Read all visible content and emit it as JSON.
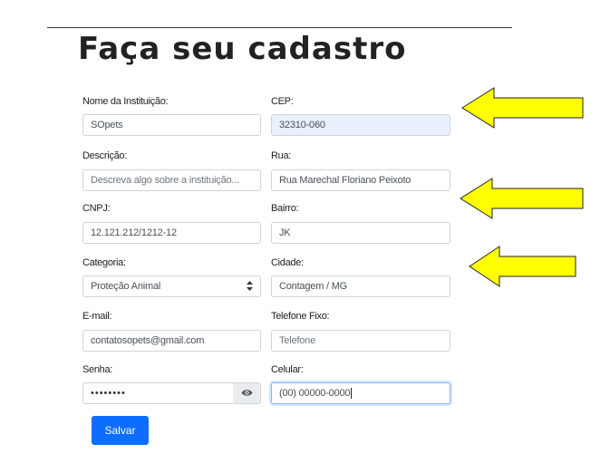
{
  "page": {
    "title": "Faça seu cadastro"
  },
  "form": {
    "nome": {
      "label": "Nome da Instituição:",
      "value": "SOpets"
    },
    "cep": {
      "label": "CEP:",
      "value": "32310-060"
    },
    "descricao": {
      "label": "Descrição:",
      "placeholder": "Descreva algo sobre a instituição..."
    },
    "rua": {
      "label": "Rua:",
      "value": "Rua Marechal Floriano Peixoto"
    },
    "cnpj": {
      "label": "CNPJ:",
      "value": "12.121.212/1212-12"
    },
    "bairro": {
      "label": "Bairro:",
      "value": "JK"
    },
    "categoria": {
      "label": "Categoria:",
      "value": "Proteção Animal"
    },
    "cidade": {
      "label": "Cidade:",
      "value": "Contagem / MG"
    },
    "email": {
      "label": "E-mail:",
      "value": "contatosopets@gmail.com"
    },
    "telefone": {
      "label": "Telefone Fixo:",
      "placeholder": "Telefone"
    },
    "senha": {
      "label": "Senha:",
      "value": "••••••••"
    },
    "celular": {
      "label": "Celular:",
      "value": "(00) 00000-0000"
    },
    "save_label": "Salvar"
  },
  "colors": {
    "accent": "#0d6efd",
    "arrow_fill": "#ffff00",
    "autofill_bg": "#e8f0fe"
  },
  "icons": {
    "password_toggle": "eye-icon",
    "select": "chevron-up-down-icon",
    "annotation": "arrow-left-icon"
  }
}
